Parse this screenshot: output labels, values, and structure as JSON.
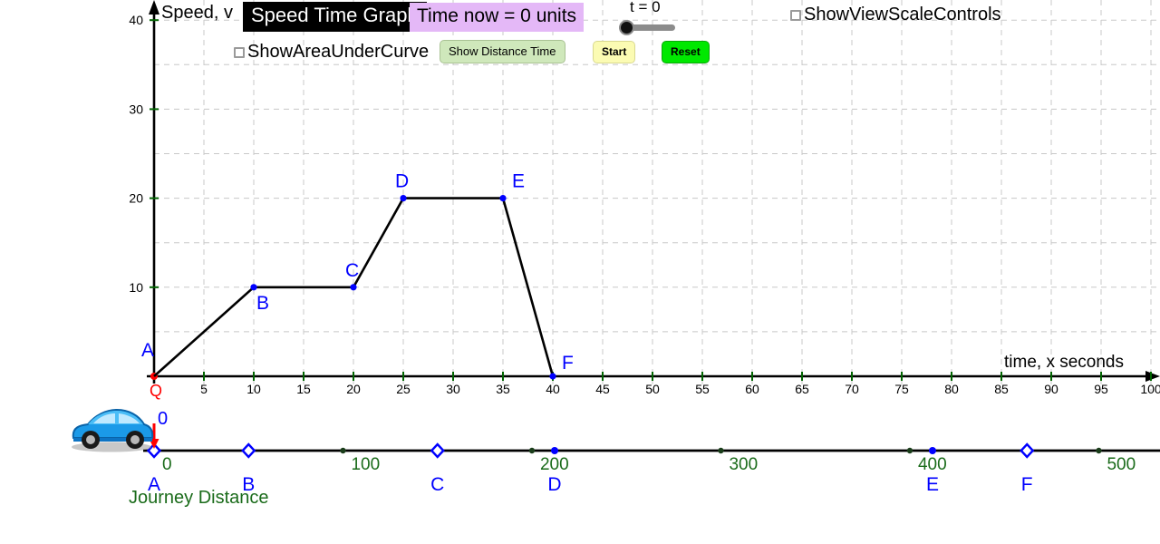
{
  "app": {
    "title": "Speed Time Graph"
  },
  "header": {
    "title_label": "Speed Time Graph",
    "time_now_label": "Time now = 0 units",
    "show_area_checkbox_label": "ShowAreaUnderCurve",
    "show_view_scale_checkbox_label": "ShowViewScaleControls",
    "show_area_checked": false,
    "show_view_scale_checked": false,
    "show_distance_time_button": "Show Distance Time",
    "start_button": "Start",
    "reset_button": "Reset",
    "slider_label": "t = 0",
    "slider_value": 0
  },
  "colors": {
    "point_blue": "#0000ff",
    "origin_red": "#ff0000",
    "axis_black": "#000000",
    "grid_gray": "#c8c8c8",
    "tick_green": "#006400",
    "distance_green": "#1a6b1a",
    "title_bg": "#000000",
    "title_fg": "#ffffff",
    "time_bg": "#e4b8f7",
    "start_bg": "#fbfbb3",
    "reset_bg": "#00e800",
    "show_distance_bg": "#cfe8bb"
  },
  "chart_data": {
    "type": "line",
    "title": "Speed Time Graph",
    "xlabel": "time,  x  seconds",
    "ylabel": "Speed, v",
    "xlim": [
      0,
      100
    ],
    "ylim": [
      0,
      42
    ],
    "grid": true,
    "x_ticks": [
      5,
      10,
      15,
      20,
      25,
      30,
      35,
      40,
      45,
      50,
      55,
      60,
      65,
      70,
      75,
      80,
      85,
      90,
      95,
      100
    ],
    "y_ticks": [
      10,
      20,
      30,
      40
    ],
    "x_tick_labels": [
      "5",
      "10",
      "15",
      "20",
      "25",
      "30",
      "35",
      "40",
      "45",
      "50",
      "55",
      "60",
      "65",
      "70",
      "75",
      "80",
      "85",
      "90",
      "95",
      "100"
    ],
    "y_tick_labels": [
      "10",
      "20",
      "30",
      "40"
    ],
    "origin_label": "Q",
    "series": [
      {
        "name": "speed",
        "points": [
          {
            "label": "A",
            "x": 0,
            "y": 0,
            "label_dx": -14,
            "label_dy": -22
          },
          {
            "label": "B",
            "x": 10,
            "y": 10,
            "label_dx": 3,
            "label_dy": 24
          },
          {
            "label": "C",
            "x": 20,
            "y": 10,
            "label_dx": -9,
            "label_dy": -12
          },
          {
            "label": "D",
            "x": 25,
            "y": 20,
            "label_dx": -9,
            "label_dy": -12
          },
          {
            "label": "E",
            "x": 35,
            "y": 20,
            "label_dx": 10,
            "label_dy": -12
          },
          {
            "label": "F",
            "x": 40,
            "y": 0,
            "label_dx": 10,
            "label_dy": -8
          }
        ]
      }
    ]
  },
  "distance_line": {
    "caption": "Journey Distance",
    "x_ticks": [
      0,
      100,
      200,
      300,
      400,
      500
    ],
    "x_tick_labels": [
      "0",
      "100",
      "200",
      "300",
      "400",
      "500"
    ],
    "max": 530,
    "car_value_label": "0",
    "car_position": 0,
    "markers": [
      {
        "label": "A",
        "value": 0,
        "shape": "diamond",
        "color": "#0000ff"
      },
      {
        "label": "B",
        "value": 50,
        "shape": "diamond",
        "color": "#0000ff"
      },
      {
        "label": "C",
        "value": 150,
        "shape": "diamond",
        "color": "#0000ff"
      },
      {
        "label": "D",
        "value": 212,
        "shape": "dot",
        "color": "#0000ff"
      },
      {
        "label": "E",
        "value": 412,
        "shape": "dot",
        "color": "#0000ff"
      },
      {
        "label": "F",
        "value": 462,
        "shape": "diamond",
        "color": "#0000ff"
      }
    ]
  }
}
